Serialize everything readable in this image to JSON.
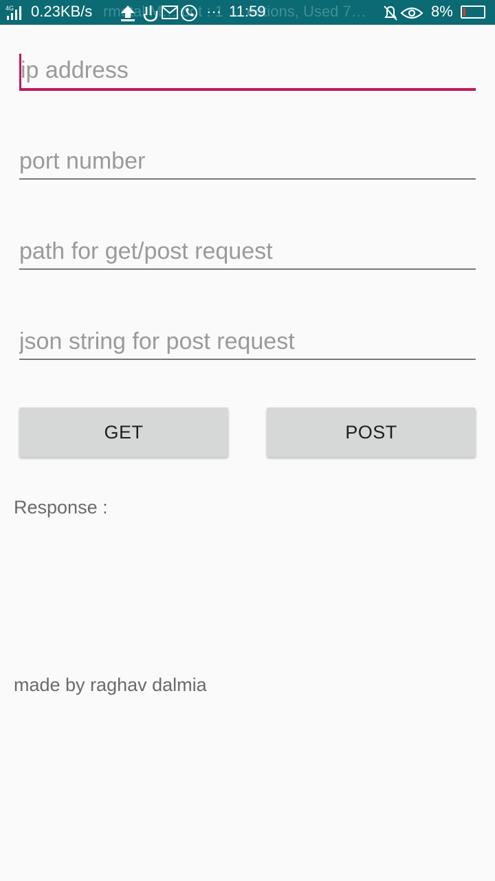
{
  "status_bar": {
    "network_type": "4G",
    "net_speed": "0.23KB/s",
    "notification_text": "rmotal M… pot : 1 … ections, Used 7…",
    "dots": "···",
    "time": "11:59",
    "battery": "8%",
    "icons": [
      "signal-icon",
      "upload-icon",
      "hand-icon",
      "mail-icon",
      "phone-icon",
      "bell-off-icon",
      "eye-icon",
      "battery-icon"
    ]
  },
  "form": {
    "ip_placeholder": "ip address",
    "port_placeholder": "port number",
    "path_placeholder": "path for get/post request",
    "json_placeholder": "json string for post request",
    "accent_color": "#c2185b"
  },
  "buttons": {
    "get_label": "GET",
    "post_label": "POST"
  },
  "response_label": "Response :",
  "credit": "made by raghav dalmia"
}
